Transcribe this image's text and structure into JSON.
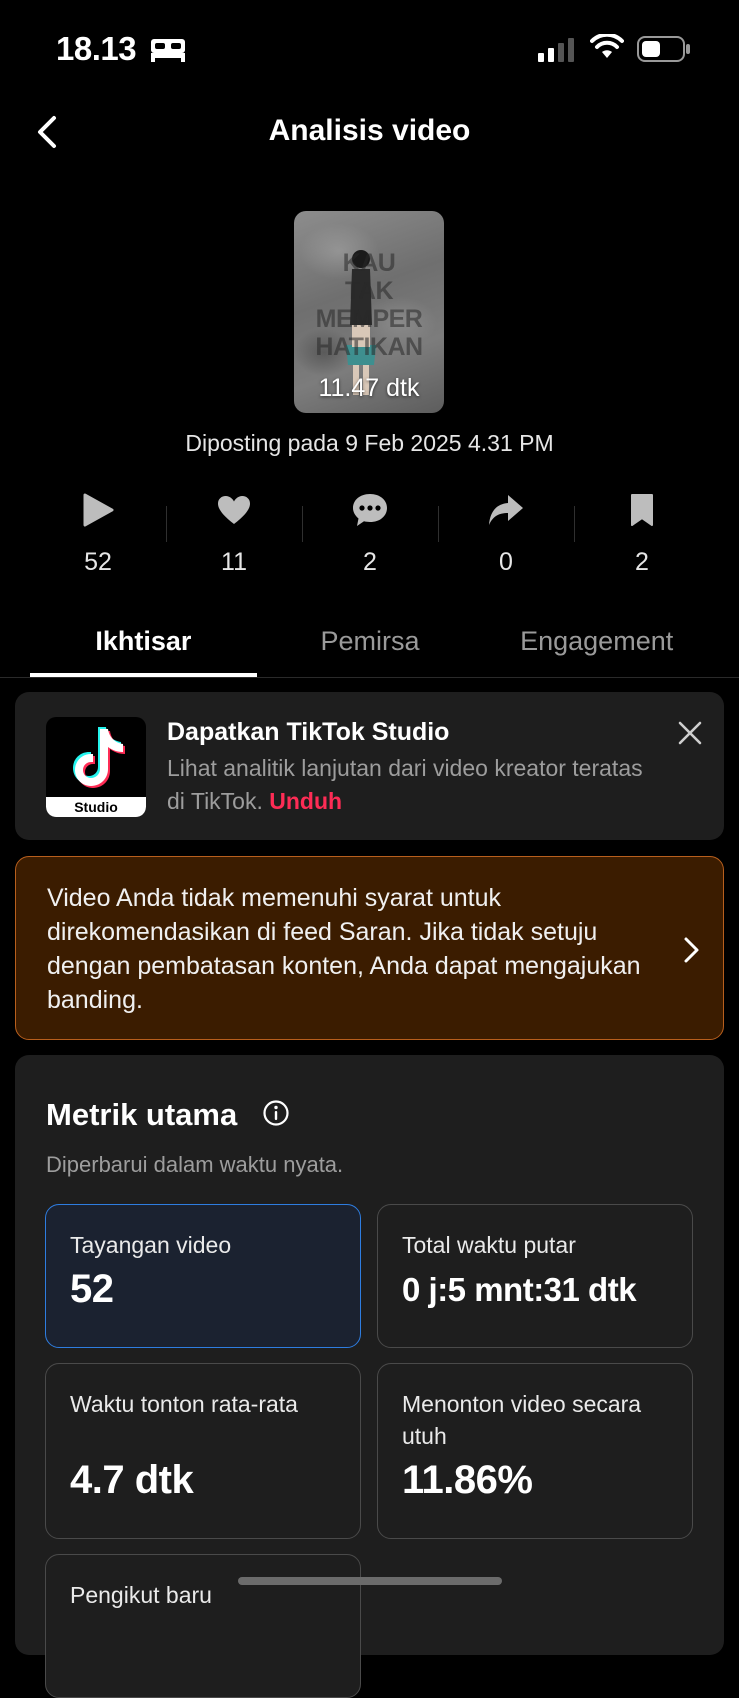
{
  "status_bar": {
    "time": "18.13"
  },
  "header": {
    "title": "Analisis video"
  },
  "video": {
    "duration": "11.47 dtk",
    "overlay_text": [
      "KAU",
      "TAK",
      "MEMPER",
      "HATIKAN"
    ],
    "posted": "Diposting pada 9 Feb 2025 4.31 PM"
  },
  "stats": [
    {
      "icon": "play-icon",
      "value": "52"
    },
    {
      "icon": "heart-icon",
      "value": "11"
    },
    {
      "icon": "comment-icon",
      "value": "2"
    },
    {
      "icon": "share-icon",
      "value": "0"
    },
    {
      "icon": "bookmark-icon",
      "value": "2"
    }
  ],
  "tabs": [
    {
      "label": "Ikhtisar",
      "active": true
    },
    {
      "label": "Pemirsa",
      "active": false
    },
    {
      "label": "Engagement",
      "active": false
    }
  ],
  "studio_promo": {
    "logo_caption": "Studio",
    "title": "Dapatkan TikTok Studio",
    "description": "Lihat analitik lanjutan dari video kreator teratas di TikTok.",
    "link": "Unduh"
  },
  "warning": {
    "text": "Video Anda tidak memenuhi syarat untuk direkomendasikan di feed Saran. Jika tidak setuju dengan pembatasan konten, Anda dapat mengajukan banding."
  },
  "metrics": {
    "title": "Metrik utama",
    "subtitle": "Diperbarui dalam waktu nyata.",
    "cards": [
      {
        "label": "Tayangan video",
        "value": "52"
      },
      {
        "label": "Total waktu putar",
        "value": "0 j:5 mnt:31 dtk"
      },
      {
        "label": "Waktu tonton rata-rata",
        "value": "4.7 dtk"
      },
      {
        "label": "Menonton video secara utuh",
        "value": "11.86%"
      },
      {
        "label": "Pengikut baru",
        "value": ""
      }
    ]
  },
  "colors": {
    "accent": "#fe2c55",
    "warning_bg": "#3b1c00",
    "warning_border": "#b85f1d",
    "selected_border": "#2e7de0"
  }
}
